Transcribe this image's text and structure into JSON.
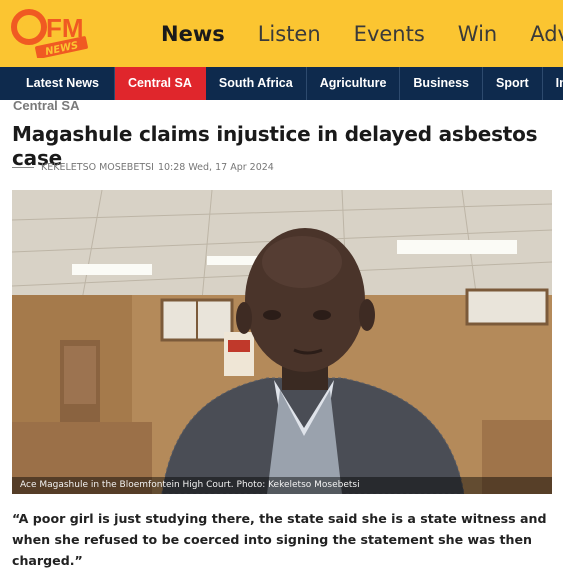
{
  "header": {
    "logo_text": "OFM",
    "logo_sub": "News",
    "nav": [
      {
        "label": "News",
        "active": true
      },
      {
        "label": "Listen",
        "active": false
      },
      {
        "label": "Events",
        "active": false
      },
      {
        "label": "Win",
        "active": false
      },
      {
        "label": "Adver",
        "active": false
      }
    ]
  },
  "subnav": [
    {
      "label": "Latest News",
      "active": false
    },
    {
      "label": "Central SA",
      "active": true
    },
    {
      "label": "South Africa",
      "active": false
    },
    {
      "label": "Agriculture",
      "active": false
    },
    {
      "label": "Business",
      "active": false
    },
    {
      "label": "Sport",
      "active": false
    },
    {
      "label": "Intern",
      "active": false
    }
  ],
  "article": {
    "section": "Central SA",
    "title": "Magashule claims injustice in delayed asbestos case",
    "author": "Kekeletso Mosebetsi",
    "datetime": "10:28 Wed, 17 Apr 2024",
    "photo_caption": "Ace Magashule in the Bloemfontein High Court. Photo: Kekeletso Mosebetsi",
    "quote": "“A poor girl is just studying there, the state said she is a state witness and when she refused to be coerced into signing the statement she was then charged.”"
  },
  "colors": {
    "header_yellow": "#fbc531",
    "subnav_navy": "#0e2a4d",
    "active_red": "#e0262c",
    "logo_orange": "#f05a22"
  }
}
